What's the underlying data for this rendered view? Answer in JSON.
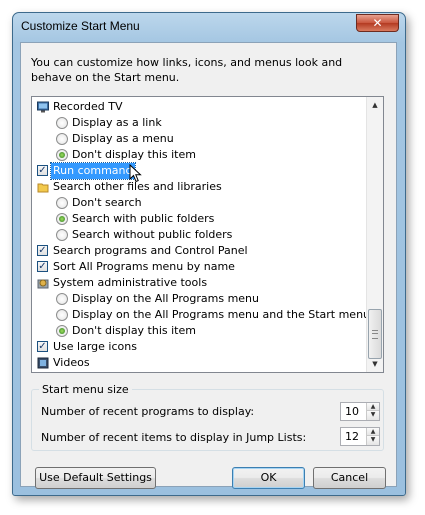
{
  "dialog": {
    "title": "Customize Start Menu",
    "close_glyph": "✕",
    "intro": "You can customize how links, icons, and menus look and behave on the Start menu."
  },
  "list": {
    "items": [
      {
        "kind": "header-icon",
        "icon": "recorded-tv-icon",
        "label": "Recorded TV"
      },
      {
        "kind": "radio",
        "checked": false,
        "label": "Display as a link"
      },
      {
        "kind": "radio",
        "checked": false,
        "label": "Display as a menu"
      },
      {
        "kind": "radio",
        "checked": true,
        "label": "Don't display this item"
      },
      {
        "kind": "checkbox",
        "checked": true,
        "label": "Run command",
        "selected": true
      },
      {
        "kind": "header-icon",
        "icon": "search-files-icon",
        "label": "Search other files and libraries"
      },
      {
        "kind": "radio",
        "checked": false,
        "label": "Don't search"
      },
      {
        "kind": "radio",
        "checked": true,
        "label": "Search with public folders"
      },
      {
        "kind": "radio",
        "checked": false,
        "label": "Search without public folders"
      },
      {
        "kind": "checkbox",
        "checked": true,
        "label": "Search programs and Control Panel"
      },
      {
        "kind": "checkbox",
        "checked": true,
        "label": "Sort All Programs menu by name"
      },
      {
        "kind": "header-icon",
        "icon": "admin-tools-icon",
        "label": "System administrative tools"
      },
      {
        "kind": "radio",
        "checked": false,
        "label": "Display on the All Programs menu"
      },
      {
        "kind": "radio",
        "checked": false,
        "label": "Display on the All Programs menu and the Start menu"
      },
      {
        "kind": "radio",
        "checked": true,
        "label": "Don't display this item"
      },
      {
        "kind": "checkbox",
        "checked": true,
        "label": "Use large icons"
      },
      {
        "kind": "header-icon",
        "icon": "videos-icon",
        "label": "Videos"
      }
    ]
  },
  "size_group": {
    "label": "Start menu size",
    "recent_programs_label": "Number of recent programs to display:",
    "recent_programs_value": "10",
    "jump_list_label": "Number of recent items to display in Jump Lists:",
    "jump_list_value": "12"
  },
  "buttons": {
    "defaults": "Use Default Settings",
    "ok": "OK",
    "cancel": "Cancel"
  }
}
